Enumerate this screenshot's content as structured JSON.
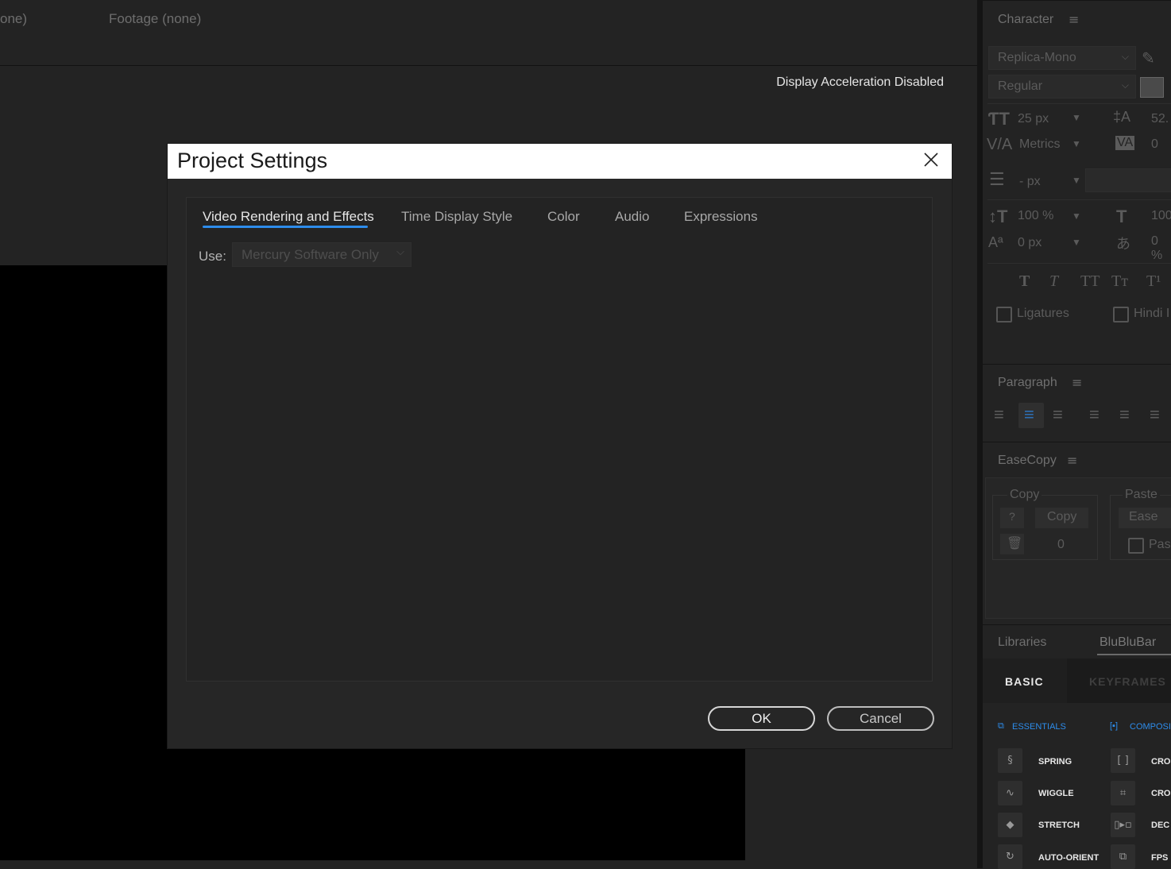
{
  "top_bar": {
    "left_fragment": "one)",
    "footage_label": "Footage  (none)"
  },
  "viewer": {
    "status": "Display Acceleration Disabled"
  },
  "dialog": {
    "title": "Project Settings",
    "tabs": [
      {
        "label": "Video Rendering and Effects",
        "active": true
      },
      {
        "label": "Time Display Style"
      },
      {
        "label": "Color"
      },
      {
        "label": "Audio"
      },
      {
        "label": "Expressions"
      }
    ],
    "use_label": "Use:",
    "use_value": "Mercury Software Only",
    "ok_label": "OK",
    "cancel_label": "Cancel"
  },
  "character_panel": {
    "title": "Character",
    "font_family": "Replica-Mono",
    "font_style": "Regular",
    "font_size": "25 px",
    "leading": "52.",
    "kerning": "Metrics",
    "tracking": "0",
    "stroke_width": "- px",
    "vert_scale": "100 %",
    "horiz_scale": "100",
    "baseline": "0 px",
    "tsume": "0 %",
    "ligatures": "Ligatures",
    "hindi": "Hindi I"
  },
  "paragraph_panel": {
    "title": "Paragraph"
  },
  "easecopy_panel": {
    "title": "EaseCopy",
    "copy_group": "Copy",
    "paste_group": "Paste",
    "help_btn": "?",
    "copy_btn": "Copy",
    "count": "0",
    "ease_btn": "Ease",
    "paste_check": "Pas"
  },
  "bottom_panel": {
    "tabs": [
      "Libraries",
      "BluBluBar"
    ],
    "subtabs": [
      "BASIC",
      "KEYFRAMES"
    ],
    "sections": [
      "ESSENTIALS",
      "COMPOSI"
    ],
    "left_items": [
      "SPRING",
      "WIGGLE",
      "STRETCH",
      "AUTO-ORIENT"
    ],
    "right_items": [
      "CRO",
      "CRO",
      "DEC",
      "FPS"
    ]
  },
  "colors": {
    "accent": "#2d8ceb",
    "dialog_bg": "#262626",
    "title_bar": "#ffffff"
  }
}
